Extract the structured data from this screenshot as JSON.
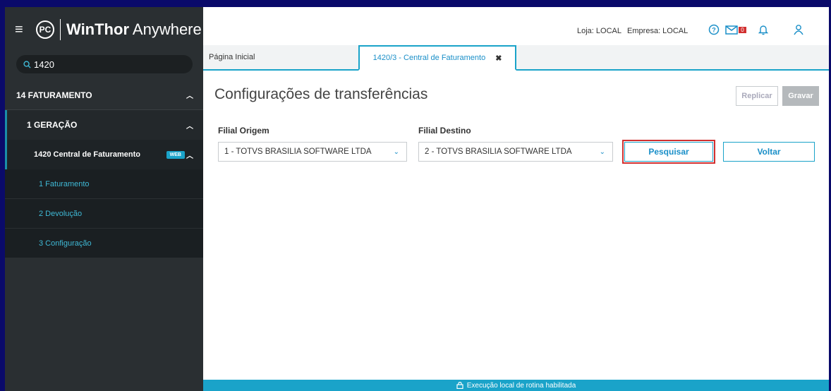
{
  "brand": {
    "logo": "PC",
    "name_bold": "WinThor",
    "name_light": "Anywhere"
  },
  "search": {
    "value": "1420"
  },
  "sidebar": {
    "items": [
      {
        "label": "14  FATURAMENTO"
      },
      {
        "label": "1  GERAÇÃO"
      },
      {
        "label": "1420  Central de Faturamento",
        "badge": "WEB"
      }
    ],
    "subitems": [
      {
        "label": "1  Faturamento"
      },
      {
        "label": "2  Devolução"
      },
      {
        "label": "3  Configuração"
      }
    ]
  },
  "header": {
    "loja": "Loja: LOCAL",
    "empresa": "Empresa: LOCAL",
    "mail_count": "0",
    "icons": [
      "help-icon",
      "mail-icon",
      "bell-icon",
      "user-icon"
    ]
  },
  "tabs": [
    {
      "label": "Página Inicial"
    },
    {
      "label": "1420/3 - Central de Faturamento",
      "close": "✖"
    }
  ],
  "main": {
    "title": "Configurações de transferências",
    "replicar_label": "Replicar",
    "gravar_label": "Gravar",
    "origem_label": "Filial Origem",
    "origem_value": "1 - TOTVS BRASILIA SOFTWARE LTDA",
    "destino_label": "Filial Destino",
    "destino_value": "2 - TOTVS BRASILIA SOFTWARE LTDA",
    "pesquisar_label": "Pesquisar",
    "voltar_label": "Voltar"
  },
  "footer": {
    "text": "Execução local de rotina habilitada"
  },
  "colors": {
    "accent": "#1aa3c9",
    "sidebar": "#2a2f32",
    "highlight": "#d12f2f"
  }
}
